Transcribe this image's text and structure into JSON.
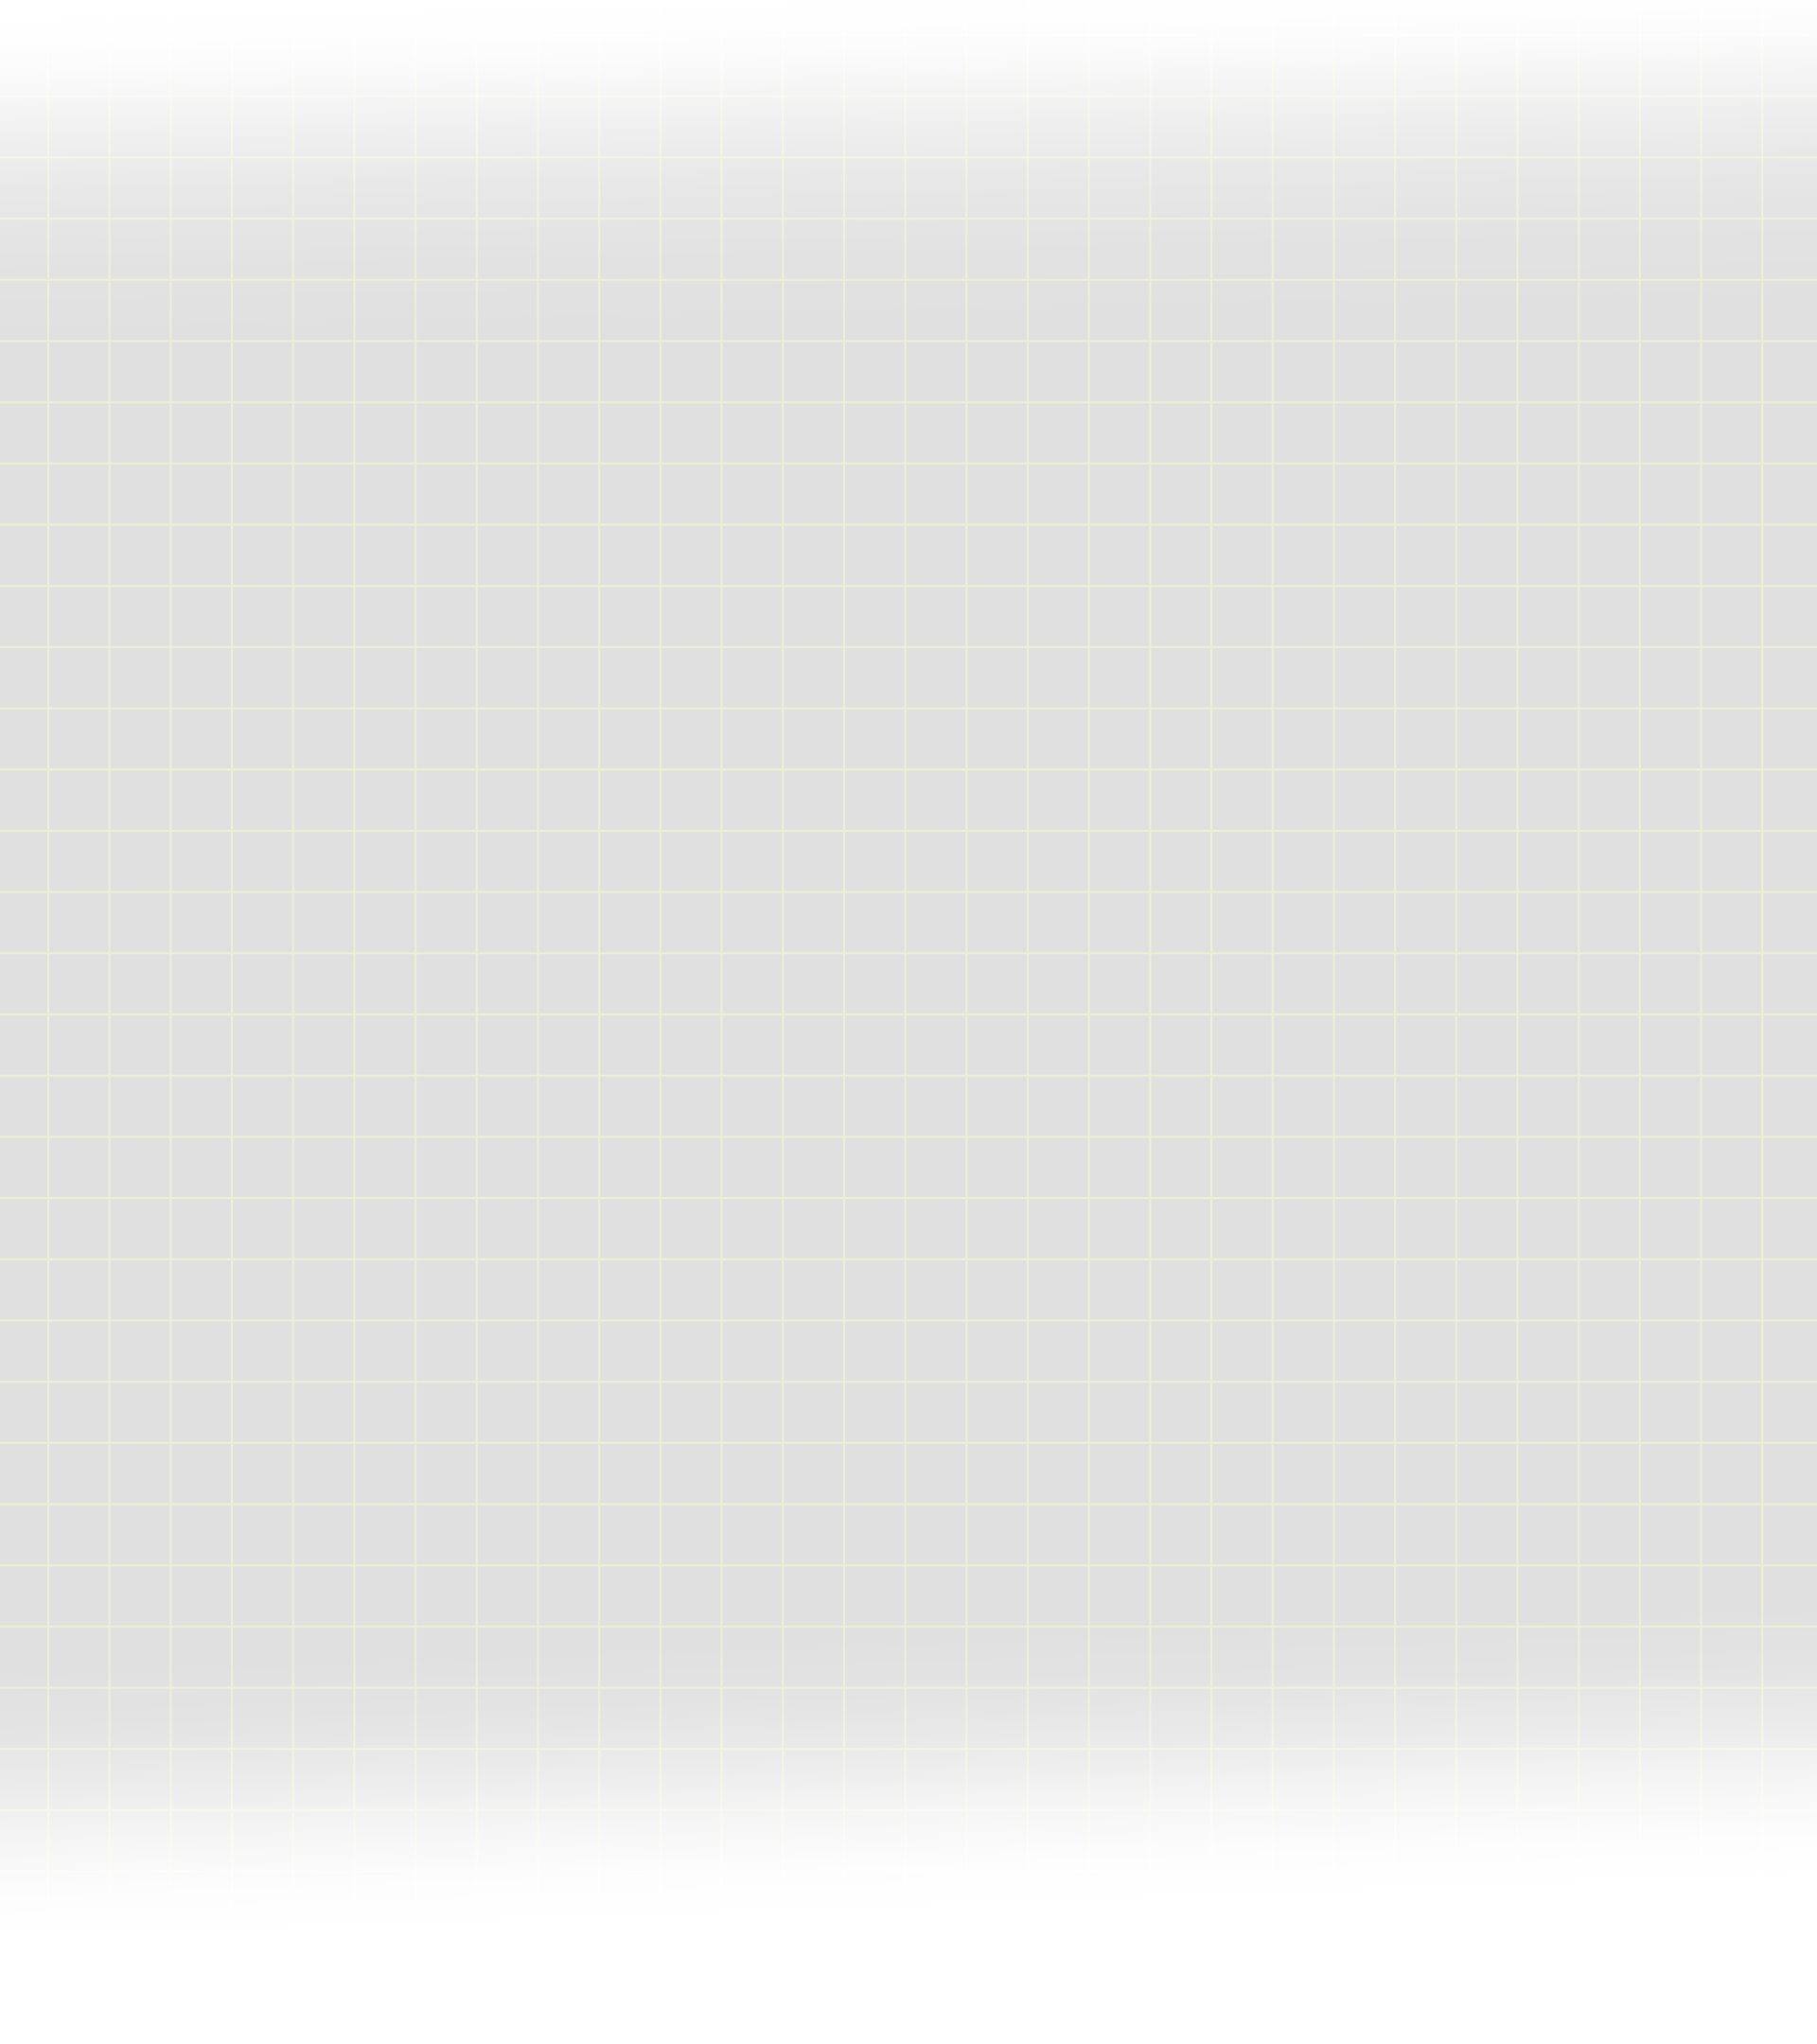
{
  "canvas": {
    "background_color": "#ffffff",
    "band_color": "#e0e0e0",
    "grid_line_color": "#efefd4",
    "pattern": "square-grid"
  }
}
